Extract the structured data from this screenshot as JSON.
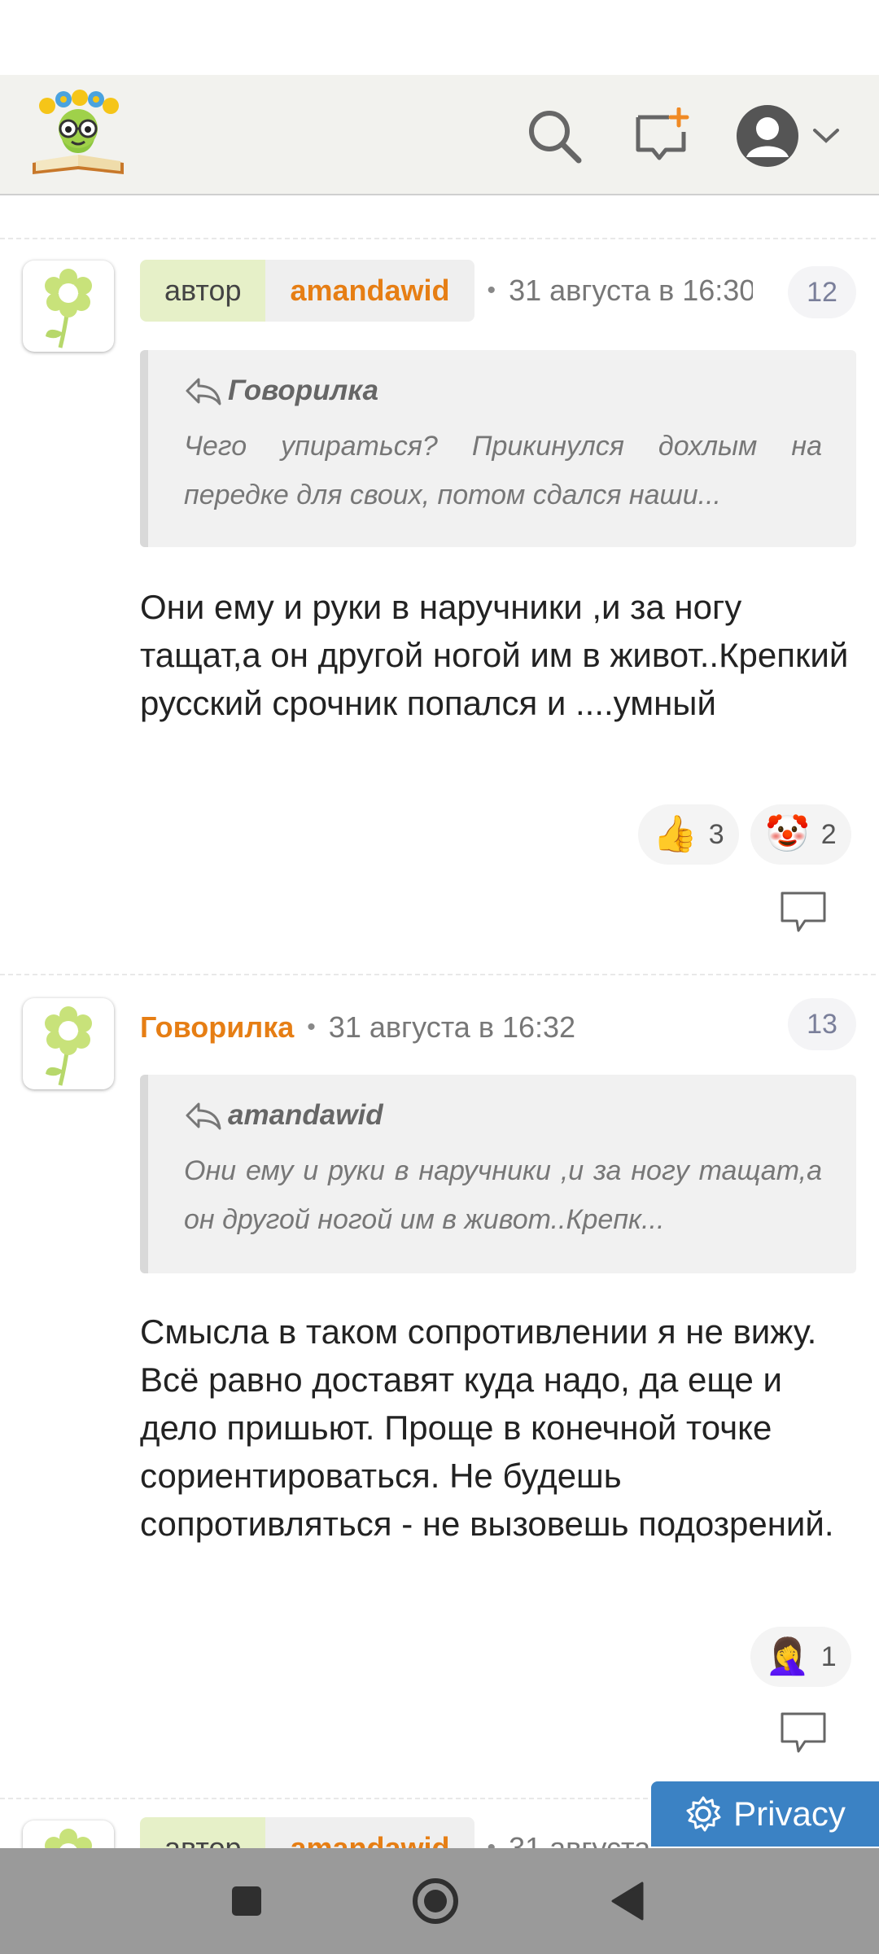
{
  "header": {
    "logo_icon": "bookworm-logo-icon",
    "search_icon": "search-icon",
    "new_post_icon": "new-message-icon",
    "profile_icon": "user-avatar-icon",
    "dropdown_icon": "chevron-down-icon"
  },
  "comments": [
    {
      "author_chip_label": "автор",
      "author": "amandawid",
      "date": "31 августа в 16:30",
      "number": "12",
      "quote_author": "Говорилка",
      "quote_text": "Чего упираться? Прикинулся дохлым на передке для своих, потом сдался наши...",
      "text": "Они ему и руки в наручники ,и за ногу тащат,а он другой ногой им в живот..Крепкий русский срочник попался и ....умный",
      "reactions": [
        {
          "emoji": "👍",
          "count": "3"
        },
        {
          "emoji": "🤡",
          "count": "2"
        }
      ]
    },
    {
      "author": "Говорилка",
      "date": "31 августа в 16:32",
      "number": "13",
      "quote_author": "amandawid",
      "quote_text": "Они ему и руки в наручники ,и за ногу тащат,а он другой ногой им в живот..Крепк...",
      "text": "Смысла в таком сопротивлении я не вижу. Всё равно доставят куда надо, да еще и дело пришьют. Проще в конечной точке сориентироваться. Не будешь сопротивляться - не вызовешь подозрений.",
      "reactions": [
        {
          "emoji": "🤦‍♀️",
          "count": "1"
        }
      ]
    },
    {
      "author_chip_label": "автор",
      "author": "amandawid",
      "date": "31 августа"
    }
  ],
  "privacy": {
    "label": "Privacy"
  },
  "colors": {
    "accent_orange": "#e67e14",
    "author_chip_bg": "#e6f0c8",
    "privacy_blue": "#3b82c4",
    "nav_bar": "#9a9a9a"
  }
}
